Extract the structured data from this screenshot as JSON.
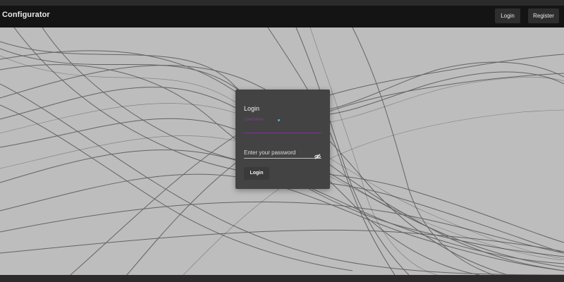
{
  "app": {
    "title": "Configurator"
  },
  "nav": {
    "login_label": "Login",
    "register_label": "Register"
  },
  "login_form": {
    "title": "Login",
    "username_label": "Username",
    "username_value": "",
    "password_placeholder": "Enter your password",
    "password_value": "",
    "submit_label": "Login",
    "visibility_icon": "eye-off-icon"
  },
  "colors": {
    "navbar_bg": "#141414",
    "page_bg": "#bdbdbd",
    "card_bg": "#434343",
    "accent": "#8e24aa",
    "required_marker": "#4db6d6"
  }
}
